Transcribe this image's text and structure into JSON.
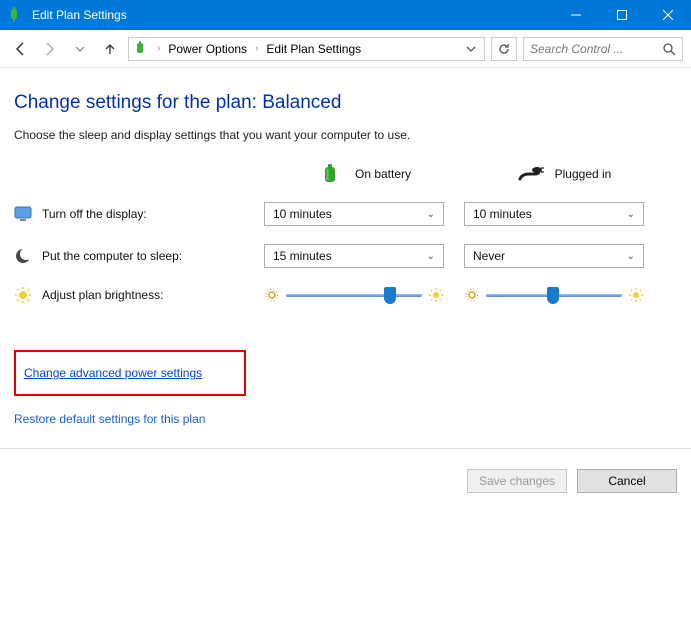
{
  "window": {
    "title": "Edit Plan Settings"
  },
  "nav": {
    "crumb1": "Power Options",
    "crumb2": "Edit Plan Settings"
  },
  "search": {
    "placeholder": "Search Control ..."
  },
  "page": {
    "heading": "Change settings for the plan: Balanced",
    "subheading": "Choose the sleep and display settings that you want your computer to use.",
    "col_battery": "On battery",
    "col_ac": "Plugged in",
    "row_display": "Turn off the display:",
    "row_sleep": "Put the computer to sleep:",
    "row_brightness": "Adjust plan brightness:"
  },
  "values": {
    "display_battery": "10 minutes",
    "display_ac": "10 minutes",
    "sleep_battery": "15 minutes",
    "sleep_ac": "Never"
  },
  "links": {
    "advanced": "Change advanced power settings",
    "restore": "Restore default settings for this plan"
  },
  "buttons": {
    "save": "Save changes",
    "cancel": "Cancel"
  }
}
